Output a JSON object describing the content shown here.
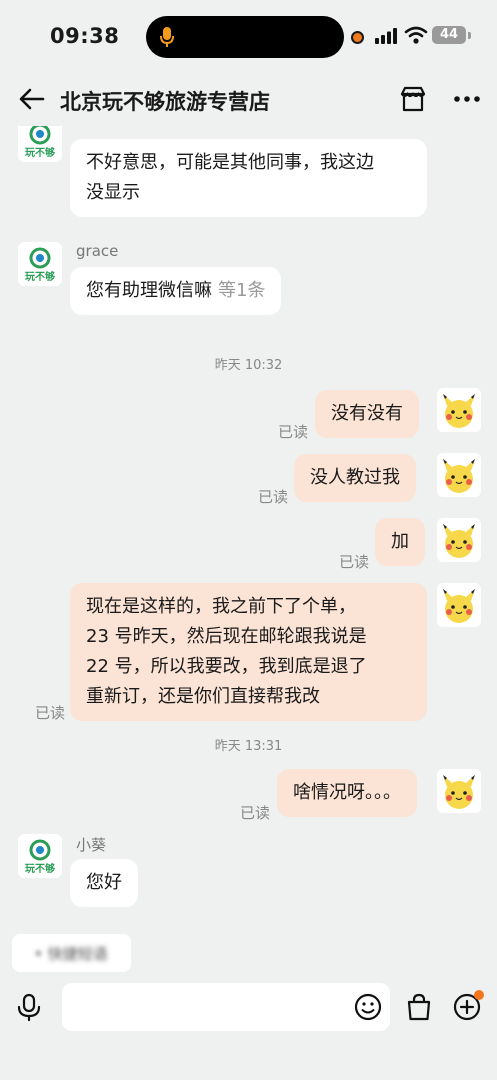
{
  "status_bar": {
    "time": "09:38",
    "battery": "44"
  },
  "header": {
    "title": "北京玩不够旅游专营店"
  },
  "brand": {
    "logo_text": "玩不够",
    "accent": "#f5761a",
    "bubble_me": "#fbe3d5",
    "bubble_them": "#ffffff"
  },
  "messages": {
    "m1": {
      "text_line1": "不好意思，可能是其他同事，我这边",
      "text_line2": "没显示"
    },
    "m2": {
      "sender": "grace",
      "text": "您有助理微信嘛",
      "more": "等1条"
    },
    "ts1": "昨天 10:32",
    "m3": {
      "text": "没有没有",
      "status": "已读"
    },
    "m4": {
      "text": "没人教过我",
      "status": "已读"
    },
    "m5": {
      "text": "加",
      "status": "已读"
    },
    "m6": {
      "line1": "现在是这样的，我之前下了个单，",
      "line2": "23 号昨天，然后现在邮轮跟我说是",
      "line3": "22 号，所以我要改，我到底是退了",
      "line4": "重新订，还是你们直接帮我改",
      "status": "已读"
    },
    "ts2": "昨天 13:31",
    "m7": {
      "text": "啥情况呀。。。",
      "status": "已读"
    },
    "m8": {
      "sender": "小葵",
      "text": "您好"
    }
  },
  "quick_reply": {
    "text": "• 快捷短语"
  },
  "input": {
    "placeholder": ""
  },
  "icons": {
    "back": "arrow-left-icon",
    "store": "store-icon",
    "more": "more-dots-icon",
    "voice": "microphone-icon",
    "emoji": "emoji-icon",
    "bag": "shopping-bag-icon",
    "plus": "plus-circle-icon"
  }
}
